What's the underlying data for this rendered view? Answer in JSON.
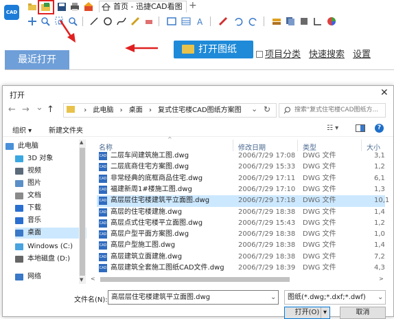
{
  "app": {
    "logo_text": "CAD",
    "tab_title": "首页 - 迅捷CAD看图",
    "tab_add": "+",
    "recent_tab": "最近打开",
    "open_drawing_button": "打开图纸",
    "project_category_label": "项目分类",
    "quick_search_link": "快速搜索",
    "settings_link": "设置"
  },
  "dialog": {
    "title": "打开",
    "close": "✕",
    "nav": {
      "back": "←",
      "forward": "→",
      "recent": "⌄",
      "up": "↑"
    },
    "breadcrumb": [
      "此电脑",
      "›",
      "桌面",
      "›",
      "复式住宅楼CAD图纸方案图"
    ],
    "address_dropdown": "⌄",
    "refresh": "↻",
    "search_placeholder": "搜索\"复式住宅楼CAD图纸方...",
    "organize_label": "组织 ▾",
    "new_folder_label": "新建文件夹",
    "view_label": "☷ ▾",
    "help_label": "?",
    "nav_pane": [
      {
        "label": "此电脑",
        "icon": "computer-icon",
        "color": "#4a90d9"
      },
      {
        "label": "3D 对象",
        "icon": "cube-icon",
        "color": "#3ba7e0"
      },
      {
        "label": "视频",
        "icon": "video-icon",
        "color": "#5b6b7a"
      },
      {
        "label": "图片",
        "icon": "picture-icon",
        "color": "#5b8fc7"
      },
      {
        "label": "文档",
        "icon": "document-icon",
        "color": "#8a8a8a"
      },
      {
        "label": "下载",
        "icon": "download-icon",
        "color": "#2a6fcf"
      },
      {
        "label": "音乐",
        "icon": "music-icon",
        "color": "#2a6fcf"
      },
      {
        "label": "桌面",
        "icon": "desktop-icon",
        "color": "#3a78c8"
      },
      {
        "label": "Windows (C:)",
        "icon": "drive-c-icon",
        "color": "#4aa3df"
      },
      {
        "label": "本地磁盘 (D:)",
        "icon": "drive-d-icon",
        "color": "#666666"
      },
      {
        "label": "网络",
        "icon": "network-icon",
        "color": "#3a78c8"
      }
    ],
    "selected_nav": "桌面",
    "columns": [
      "名称",
      "修改日期",
      "类型",
      "大小"
    ],
    "sort_caret": "^",
    "files": [
      {
        "name": "二层车间建筑施工图.dwg",
        "date": "2006/7/29 17:08",
        "type": "DWG 文件",
        "size": "3,1"
      },
      {
        "name": "二层底商住宅方案图.dwg",
        "date": "2006/7/29 15:33",
        "type": "DWG 文件",
        "size": "1,2"
      },
      {
        "name": "非常经典的底框商品住宅.dwg",
        "date": "2006/7/29 17:11",
        "type": "DWG 文件",
        "size": "6,1"
      },
      {
        "name": "福建新周1#楼施工图.dwg",
        "date": "2006/7/29 17:10",
        "type": "DWG 文件",
        "size": "1,3"
      },
      {
        "name": "高层层住宅楼建筑平立面图.dwg",
        "date": "2006/7/29 17:18",
        "type": "DWG 文件",
        "size": "10,1"
      },
      {
        "name": "高层的住宅楼建施.dwg",
        "date": "2006/7/29 18:38",
        "type": "DWG 文件",
        "size": "1,4"
      },
      {
        "name": "高层点式住宅楼平立面图.dwg",
        "date": "2006/7/29 15:43",
        "type": "DWG 文件",
        "size": "1,2"
      },
      {
        "name": "高层户型平面方案图.dwg",
        "date": "2006/7/29 18:38",
        "type": "DWG 文件",
        "size": "1,0"
      },
      {
        "name": "高层户型施工图.dwg",
        "date": "2006/7/29 18:38",
        "type": "DWG 文件",
        "size": "1,4"
      },
      {
        "name": "高层建筑立面建施.dwg",
        "date": "2006/7/29 18:38",
        "type": "DWG 文件",
        "size": "7,2"
      },
      {
        "name": "高层建筑全套施工图纸CAD文件.dwg",
        "date": "2006/7/29 18:39",
        "type": "DWG 文件",
        "size": "4,3"
      }
    ],
    "selected_file_index": 4,
    "file_icon_text": "CAD",
    "filename_label": "文件名(N):",
    "filename_value": "高层层住宅楼建筑平立面图.dwg",
    "filter_value": "图纸(*.dwg;*.dxf;*.dwf)",
    "open_button": "打开(O)",
    "open_dropdown": "▾",
    "cancel_button": "取消"
  },
  "colors": {
    "accent_red": "#e02020",
    "brand_blue": "#1e8ad8",
    "selection": "#cce8ff"
  }
}
